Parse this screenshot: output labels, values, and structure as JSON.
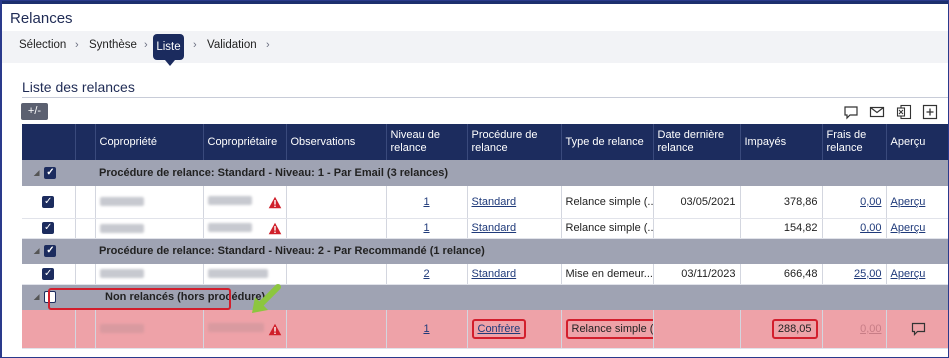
{
  "app": {
    "title": "Relances"
  },
  "wizard": {
    "steps": [
      "Sélection",
      "Synthèse",
      "Liste",
      "Validation"
    ],
    "active": "Liste"
  },
  "section": {
    "title": "Liste des relances",
    "toggle_label": "+/-"
  },
  "toolbar_icons": [
    "comment-icon",
    "mail-icon",
    "excel-icon",
    "add-icon"
  ],
  "columns": [
    "Copropriété",
    "Copropriétaire",
    "Observations",
    "Niveau de relance",
    "Procédure de relance",
    "Type de relance",
    "Date dernière relance",
    "Impayés",
    "Frais de relance",
    "Aperçu"
  ],
  "groups": [
    {
      "label": "Procédure de relance: Standard - Niveau: 1 - Par Email (3 relances)",
      "rows": [
        {
          "niveau": "1",
          "procedure": "Standard",
          "type": "Relance simple  (...",
          "date": "03/05/2021",
          "impayes": "378,86",
          "frais": "0,00",
          "apercu": "Aperçu"
        },
        {
          "niveau": "1",
          "procedure": "Standard",
          "type": "Relance simple  (...",
          "date": "",
          "impayes": "154,82",
          "frais": "0,00",
          "apercu": "Aperçu"
        }
      ]
    },
    {
      "label": "Procédure de relance: Standard - Niveau: 2 - Par Recommandé (1 relance)",
      "rows": [
        {
          "niveau": "2",
          "procedure": "Standard",
          "type": "Mise en demeur...",
          "date": "03/11/2023",
          "impayes": "666,48",
          "frais": "25,00",
          "apercu": "Aperçu"
        }
      ]
    },
    {
      "label": "Non relancés (hors procédure)",
      "rows": [
        {
          "niveau": "1",
          "procedure": "Confrère",
          "type": "Relance simple  (...",
          "date": "",
          "impayes": "288,05",
          "frais": "0,00",
          "apercu": "comment-icon"
        }
      ]
    }
  ],
  "colors": {
    "header_bg": "#1c2c5e",
    "group_bg": "#9fa3b3",
    "alert_row_bg": "#eea2a8",
    "highlight_border": "#d21f2d",
    "annotation_arrow": "#8cc63f"
  }
}
